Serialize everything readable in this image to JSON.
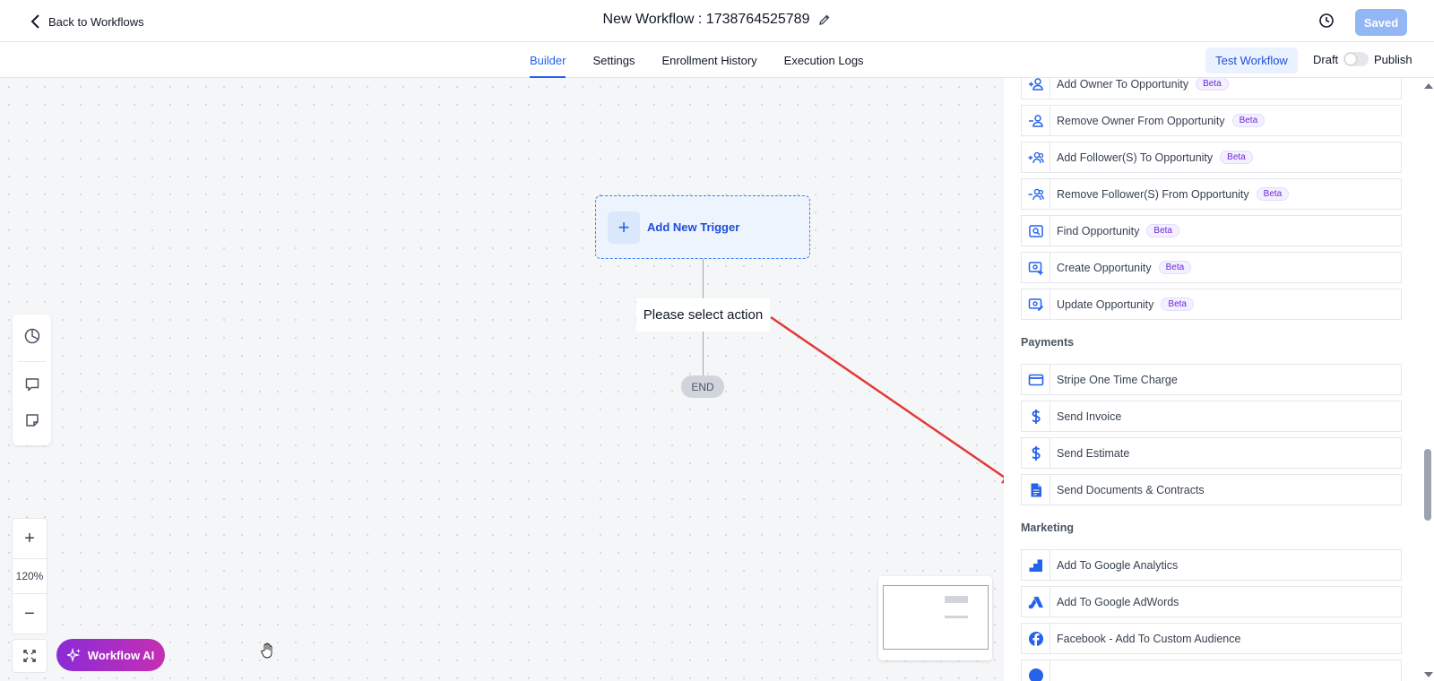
{
  "header": {
    "back_label": "Back to Workflows",
    "title": "New Workflow : 1738764525789",
    "saved_label": "Saved"
  },
  "tabs": [
    {
      "label": "Builder",
      "active": true
    },
    {
      "label": "Settings",
      "active": false
    },
    {
      "label": "Enrollment History",
      "active": false
    },
    {
      "label": "Execution Logs",
      "active": false
    }
  ],
  "toolbar": {
    "test_label": "Test Workflow",
    "draft_label": "Draft",
    "publish_label": "Publish",
    "publish_toggle_on": false
  },
  "canvas": {
    "trigger_label": "Add New Trigger",
    "action_label": "Please select action",
    "end_label": "END",
    "zoom_level": "120%",
    "ai_label": "Workflow AI"
  },
  "panel": {
    "opportunity_items": [
      {
        "label": "Add Owner To Opportunity",
        "badge": "Beta",
        "icon": "person-add-icon"
      },
      {
        "label": "Remove Owner From Opportunity",
        "badge": "Beta",
        "icon": "person-remove-icon"
      },
      {
        "label": "Add Follower(S) To Opportunity",
        "badge": "Beta",
        "icon": "people-add-icon"
      },
      {
        "label": "Remove Follower(S) From Opportunity",
        "badge": "Beta",
        "icon": "people-remove-icon"
      },
      {
        "label": "Find Opportunity",
        "badge": "Beta",
        "icon": "find-opportunity-icon"
      },
      {
        "label": "Create Opportunity",
        "badge": "Beta",
        "icon": "create-opportunity-icon"
      },
      {
        "label": "Update Opportunity",
        "badge": "Beta",
        "icon": "update-opportunity-icon"
      }
    ],
    "payments_title": "Payments",
    "payments_items": [
      {
        "label": "Stripe One Time Charge",
        "icon": "credit-card-icon"
      },
      {
        "label": "Send Invoice",
        "icon": "dollar-icon"
      },
      {
        "label": "Send Estimate",
        "icon": "dollar-icon"
      },
      {
        "label": "Send Documents & Contracts",
        "icon": "document-icon"
      }
    ],
    "marketing_title": "Marketing",
    "marketing_items": [
      {
        "label": "Add To Google Analytics",
        "icon": "google-analytics-icon"
      },
      {
        "label": "Add To Google AdWords",
        "icon": "google-adwords-icon"
      },
      {
        "label": "Facebook - Add To Custom Audience",
        "icon": "facebook-icon"
      }
    ]
  },
  "colors": {
    "primary": "#2563eb",
    "saved_button": "#93b6f5",
    "annotation_arrow": "#e03a3a",
    "ai_gradient_start": "#8b2bd6",
    "ai_gradient_end": "#c52fb3"
  }
}
